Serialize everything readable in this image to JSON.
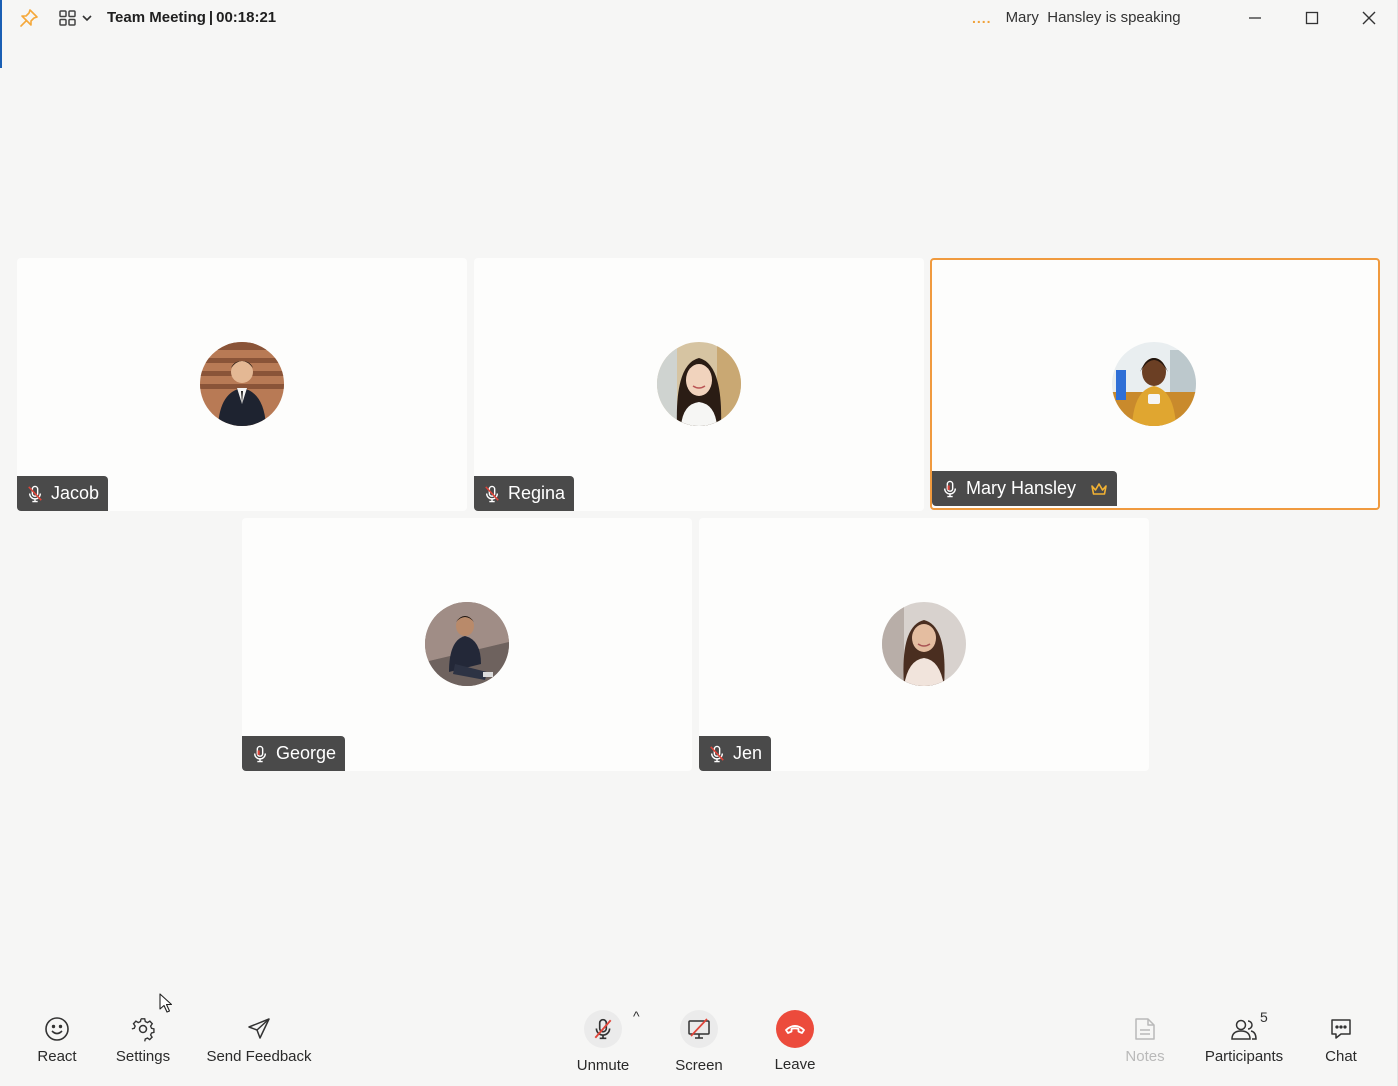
{
  "titlebar": {
    "meeting_title": "Team Meeting",
    "separator": "|",
    "elapsed": "00:18:21",
    "speaking_status": "Mary  Hansley is speaking",
    "pin_icon": "pin-icon",
    "layout_icon": "grid-layout-icon"
  },
  "participants": [
    {
      "name": "Jacob",
      "mic": "muted",
      "active_speaker": false
    },
    {
      "name": "Regina",
      "mic": "muted",
      "active_speaker": false
    },
    {
      "name": "Mary Hansley",
      "mic": "on",
      "host": true,
      "active_speaker": true
    },
    {
      "name": "George",
      "mic": "on",
      "active_speaker": false
    },
    {
      "name": "Jen",
      "mic": "muted",
      "active_speaker": false
    }
  ],
  "toolbar": {
    "react": "React",
    "settings": "Settings",
    "send_feedback": "Send Feedback",
    "unmute": "Unmute",
    "screen": "Screen",
    "leave": "Leave",
    "notes": "Notes",
    "participants": "Participants",
    "participants_count": "5",
    "chat": "Chat"
  },
  "colors": {
    "accent": "#f09a3e",
    "leave": "#ec4b3c",
    "tag_bg": "#4a4a4a",
    "background": "#f6f6f5"
  }
}
